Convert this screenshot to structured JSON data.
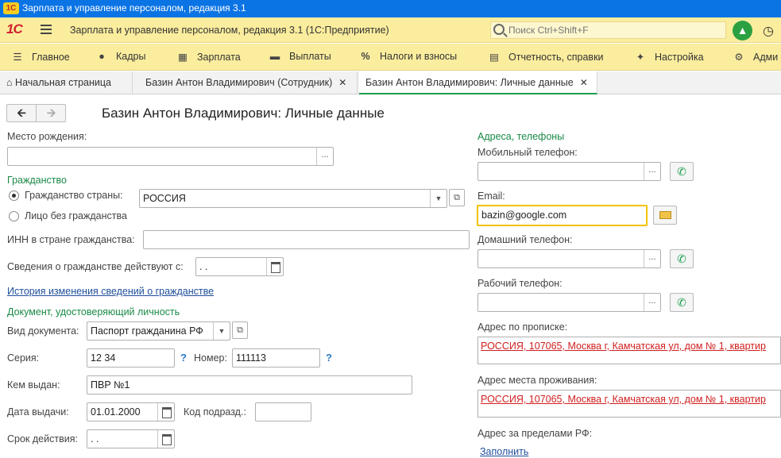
{
  "window": {
    "title": "Зарплата и управление персоналом, редакция 3.1"
  },
  "app": {
    "logo": "1С",
    "title": "Зарплата и управление персоналом, редакция 3.1  (1С:Предприятие)",
    "search_placeholder": "Поиск Ctrl+Shift+F"
  },
  "menu": [
    {
      "label": "Главное",
      "icon": "menu-icon"
    },
    {
      "label": "Кадры",
      "icon": "people-icon"
    },
    {
      "label": "Зарплата",
      "icon": "calculator-icon"
    },
    {
      "label": "Выплаты",
      "icon": "wallet-icon"
    },
    {
      "label": "Налоги и взносы",
      "icon": "percent-icon"
    },
    {
      "label": "Отчетность, справки",
      "icon": "report-icon"
    },
    {
      "label": "Настройка",
      "icon": "wrench-icon"
    },
    {
      "label": "Адми",
      "icon": "gear-icon"
    }
  ],
  "tabs": [
    {
      "label": "Начальная страница"
    },
    {
      "label": "Базин Антон Владимирович (Сотрудник)"
    },
    {
      "label": "Базин Антон Владимирович: Личные данные"
    }
  ],
  "form": {
    "title": "Базин Антон Владимирович: Личные данные",
    "birthplace_label": "Место рождения:",
    "birthplace_value": "",
    "citizenship_group": "Гражданство",
    "citizenship_country_label": "Гражданство страны:",
    "citizenship_country_value": "РОССИЯ",
    "stateless_label": "Лицо без гражданства",
    "inn_label": "ИНН в стране гражданства:",
    "inn_value": "",
    "citizenship_from_label": "Сведения о гражданстве действуют с:",
    "citizenship_from_value": " .  .",
    "history_link": "История изменения сведений о гражданстве",
    "document_group": "Документ, удостоверяющий личность",
    "doc_type_label": "Вид документа:",
    "doc_type_value": "Паспорт гражданина РФ",
    "series_label": "Серия:",
    "series_value": "12 34",
    "number_label": "Номер:",
    "number_value": "111113",
    "issued_by_label": "Кем выдан:",
    "issued_by_value": "ПВР №1",
    "issue_date_label": "Дата выдачи:",
    "issue_date_value": "01.01.2000",
    "division_code_label": "Код подразд.:",
    "division_code_value": "",
    "validity_label": "Срок действия:",
    "validity_value": " .  .",
    "question_mark": "?"
  },
  "contacts": {
    "group": "Адреса, телефоны",
    "mobile_label": "Мобильный телефон:",
    "mobile_value": "",
    "email_label": "Email:",
    "email_value": "bazin@google.com",
    "home_label": "Домашний телефон:",
    "home_value": "",
    "work_label": "Рабочий телефон:",
    "work_value": "",
    "reg_address_label": "Адрес по прописке:",
    "reg_address_value": "РОССИЯ, 107065, Москва г, Камчатская ул, дом № 1, квартир",
    "live_address_label": "Адрес места проживания:",
    "live_address_value": "РОССИЯ, 107065, Москва г, Камчатская ул, дом № 1, квартир",
    "foreign_address_label": "Адрес за пределами РФ:",
    "fill_link": "Заполнить"
  },
  "colors": {
    "titlebar": "#0b74e5",
    "header": "#fbed9e",
    "group_text": "#1a8a47",
    "link": "#1f4e9a",
    "address_text": "#d02020",
    "focus": "#f2c200"
  }
}
